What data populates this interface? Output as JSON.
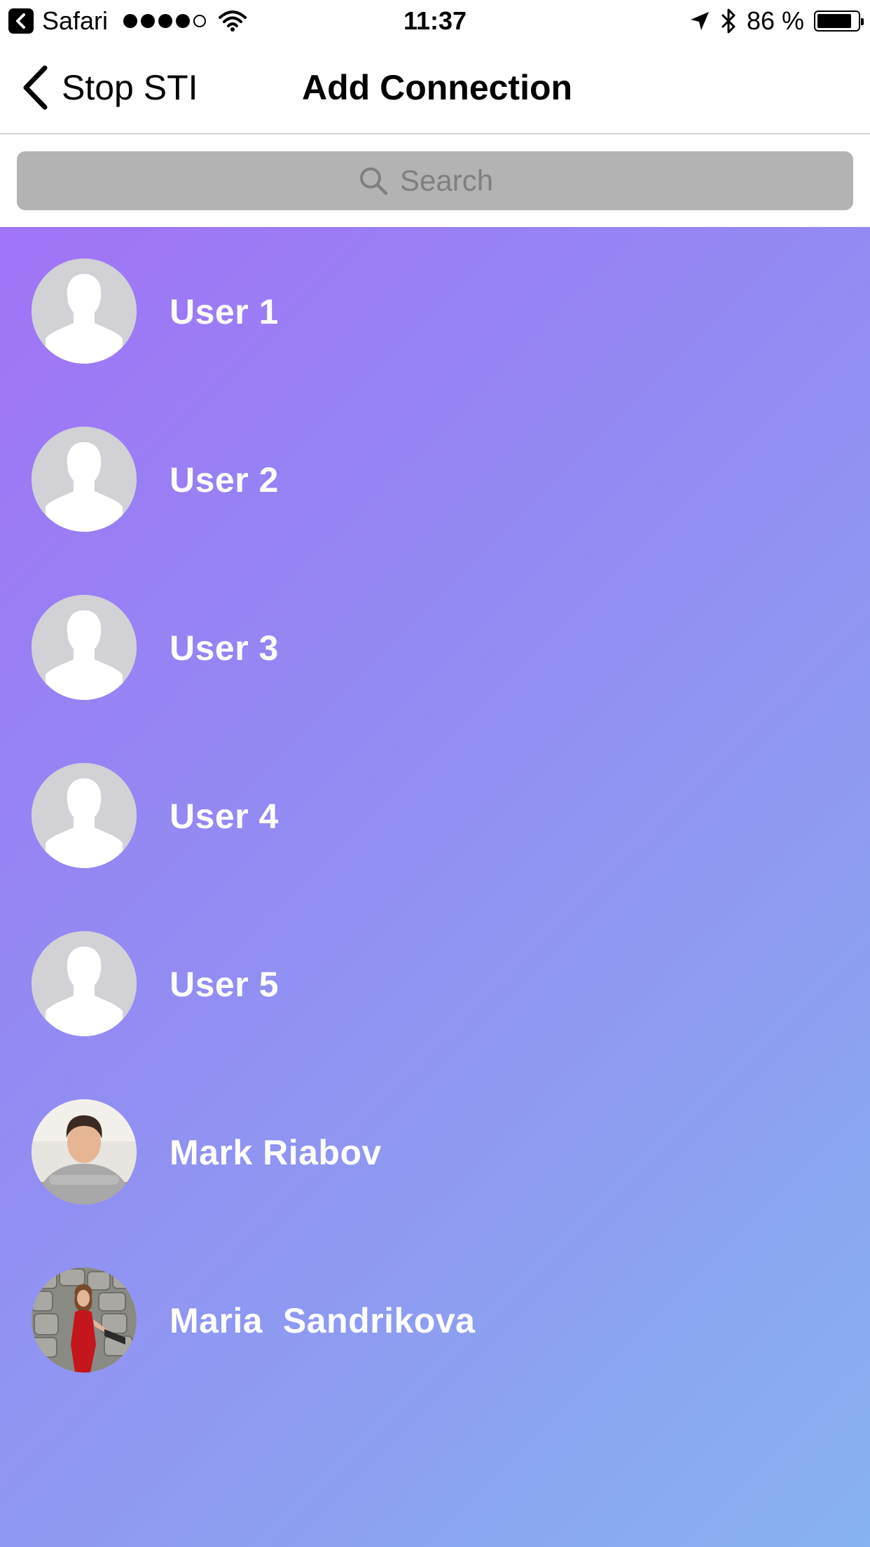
{
  "status_bar": {
    "app_name": "Safari",
    "time": "11:37",
    "battery_percent": "86 %",
    "battery_level": 0.86,
    "signal_bars_filled": 4,
    "signal_bars_total": 5
  },
  "nav": {
    "back_label": "Stop STI",
    "title": "Add Connection"
  },
  "search": {
    "placeholder": "Search",
    "value": ""
  },
  "users": [
    {
      "name": "User 1",
      "avatar": "default-silhouette"
    },
    {
      "name": "User 2",
      "avatar": "default-silhouette"
    },
    {
      "name": "User 3",
      "avatar": "default-silhouette"
    },
    {
      "name": "User 4",
      "avatar": "default-silhouette"
    },
    {
      "name": "User 5",
      "avatar": "default-silhouette"
    },
    {
      "name": "Mark Riabov",
      "avatar": "photo"
    },
    {
      "name": "Maria  Sandrikova",
      "avatar": "photo"
    }
  ],
  "colors": {
    "gradient_start": "#a173f6",
    "gradient_end": "#87b3f0",
    "search_bar_bg": "#b3b3b3",
    "avatar_placeholder": "#d1d1d6"
  }
}
